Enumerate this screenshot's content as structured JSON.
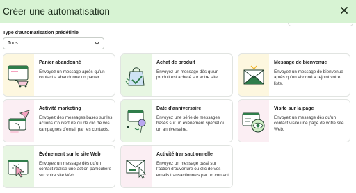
{
  "header": {
    "title": "Créer une automatisation",
    "close_icon": "close-icon"
  },
  "filter": {
    "label": "Type d'automatisation prédéfinie",
    "selected": "Tous"
  },
  "colors": {
    "header_bg": "#d7f3d3",
    "accent": "#2f7d4a"
  },
  "cards": [
    {
      "title": "Panier abandonné",
      "description": "Envoyez un message après qu'un contact a abandonné un panier.",
      "icon": "shopping-cart-icon"
    },
    {
      "title": "Achat de produit",
      "description": "Envoyez un message dès qu'un produit est acheté sur votre site.",
      "icon": "shopping-bag-icon"
    },
    {
      "title": "Message de bienvenue",
      "description": "Envoyez un message de bienvenue après qu'un abonné a rejoint votre liste.",
      "icon": "envelope-icon"
    },
    {
      "title": "Activité marketing",
      "description": "Envoyez des messages basés sur les actions d'ouverture ou de clic de vos campagnes d'email par les contacts.",
      "icon": "paper-plane-icon"
    },
    {
      "title": "Date d'anniversaire",
      "description": "Envoyez une série de messages basés sur un événement spécial ou un anniversaire.",
      "icon": "calendar-balloons-icon"
    },
    {
      "title": "Visite sur la page",
      "description": "Envoyez un message dès qu'un contact visite une page de votre site Web.",
      "icon": "browser-eye-icon"
    },
    {
      "title": "Événement sur le site Web",
      "description": "Envoyez un message dès qu'un contact réalise une action particulière sur votre site Web.",
      "icon": "browser-click-icon"
    },
    {
      "title": "Activité transactionnelle",
      "description": "Envoyez un message basé sur l'action d'ouverture ou clic de vos emails transactionnels par un contact.",
      "icon": "email-cursor-icon"
    }
  ]
}
